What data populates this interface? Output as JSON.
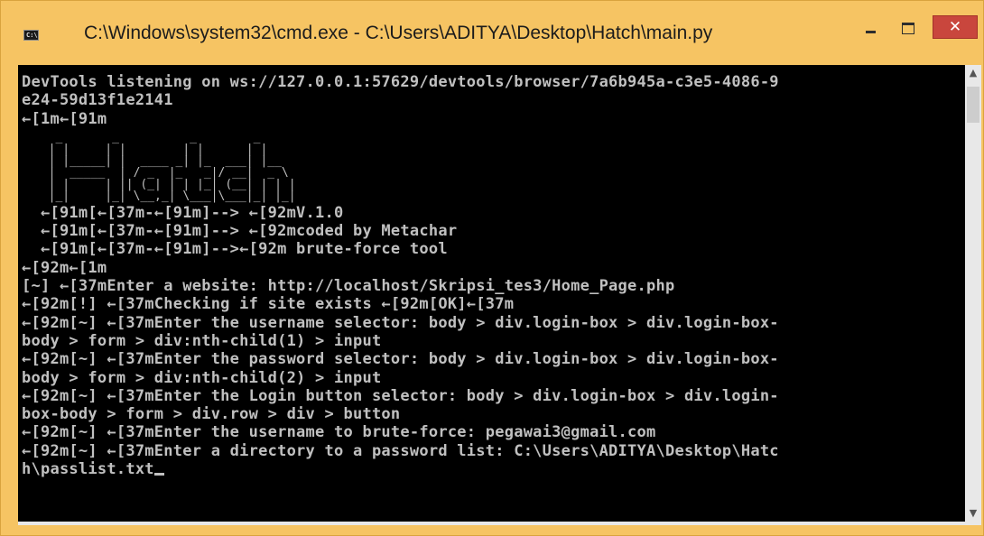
{
  "window": {
    "title": "C:\\Windows\\system32\\cmd.exe - C:\\Users\\ADITYA\\Desktop\\Hatch\\main.py",
    "icon": "cmd-icon",
    "icon_text": "C:\\",
    "close_glyph": "✕",
    "accent_color": "#f6c463",
    "close_color": "#c9463d"
  },
  "console": {
    "background": "#000000",
    "text_color": "#c0c0c0",
    "lines_before_logo": [
      "DevTools listening on ws://127.0.0.1:57629/devtools/browser/7a6b945a-c3e5-4086-9",
      "e24-59d13f1e2141",
      "←[1m←[91m"
    ],
    "logo_ascii": [
      "   _       _          _        _",
      "  | |     | |        | |      | |",
      "  | |_____| |  ____ _| |_  ___| |__",
      "  |  _____  | / _  |_   _|/ __|  _ \\",
      "  | |     | || (_| | | |_| (__| | | |",
      "  |_|     |_| \\__,_| \\___|\\___|_| |_|"
    ],
    "lines_after_logo": [
      "  ←[91m[←[37m-←[91m]--> ←[92mV.1.0",
      "  ←[91m[←[37m-←[91m]--> ←[92mcoded by Metachar",
      "  ←[91m[←[37m-←[91m]-->←[92m brute-force tool",
      "←[92m←[1m",
      "[~] ←[37mEnter a website: http://localhost/Skripsi_tes3/Home_Page.php",
      "←[92m[!] ←[37mChecking if site exists ←[92m[OK]←[37m",
      "←[92m[~] ←[37mEnter the username selector: body > div.login-box > div.login-box-",
      "body > form > div:nth-child(1) > input",
      "←[92m[~] ←[37mEnter the password selector: body > div.login-box > div.login-box-",
      "body > form > div:nth-child(2) > input",
      "←[92m[~] ←[37mEnter the Login button selector: body > div.login-box > div.login-",
      "box-body > form > div.row > div > button",
      "←[92m[~] ←[37mEnter the username to brute-force: pegawai3@gmail.com",
      "←[92m[~] ←[37mEnter a directory to a password list: C:\\Users\\ADITYA\\Desktop\\Hatc"
    ],
    "current_input": "h\\passlist.txt"
  }
}
